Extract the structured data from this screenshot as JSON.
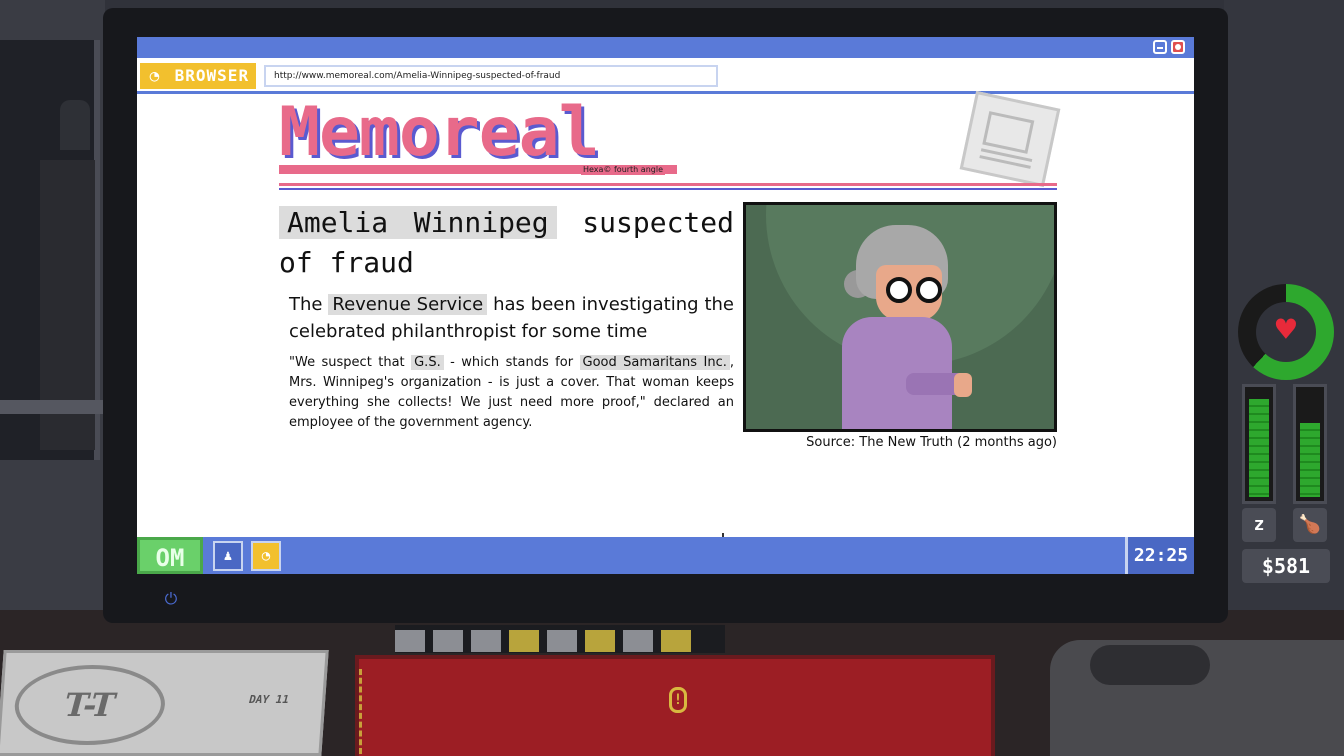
{
  "browser": {
    "tab_label": "BROWSER",
    "url": "http://www.memoreal.com/Amelia-Winnipeg-suspected-of-fraud"
  },
  "article": {
    "site_name": "Memoreal",
    "site_tagline": "Hexa© fourth angle",
    "headline_highlight": "Amelia Winnipeg",
    "headline_rest": "suspected of fraud",
    "subhead_pre": "The",
    "subhead_highlight": "Revenue Service",
    "subhead_post": "has been investigating the celebrated philanthropist for some time",
    "quote_1": "\"We suspect that",
    "quote_hl_1": "G.S.",
    "quote_2": "- which stands for",
    "quote_hl_2": "Good Samaritans Inc.",
    "quote_3": ", Mrs. Winnipeg's organization - is just a cover. That woman keeps everything she collects! We just need more proof,\" declared an employee of the government agency.",
    "photo_caption": "Source: The New Truth (2 months ago)"
  },
  "taskbar": {
    "start_label": "OM",
    "clock": "22:25"
  },
  "hud": {
    "health_fraction": 0.62,
    "sleep_level": 0.92,
    "food_level": 0.7,
    "money": "$581"
  },
  "desk": {
    "day_label": "DAY 11",
    "paper_logo": "T-T"
  },
  "colors": {
    "window_blue": "#5a7ad8",
    "browser_yellow": "#f2c02e",
    "masthead_pink": "#e86a8a",
    "start_green": "#6ad06a",
    "health_green": "#2ea82e"
  }
}
